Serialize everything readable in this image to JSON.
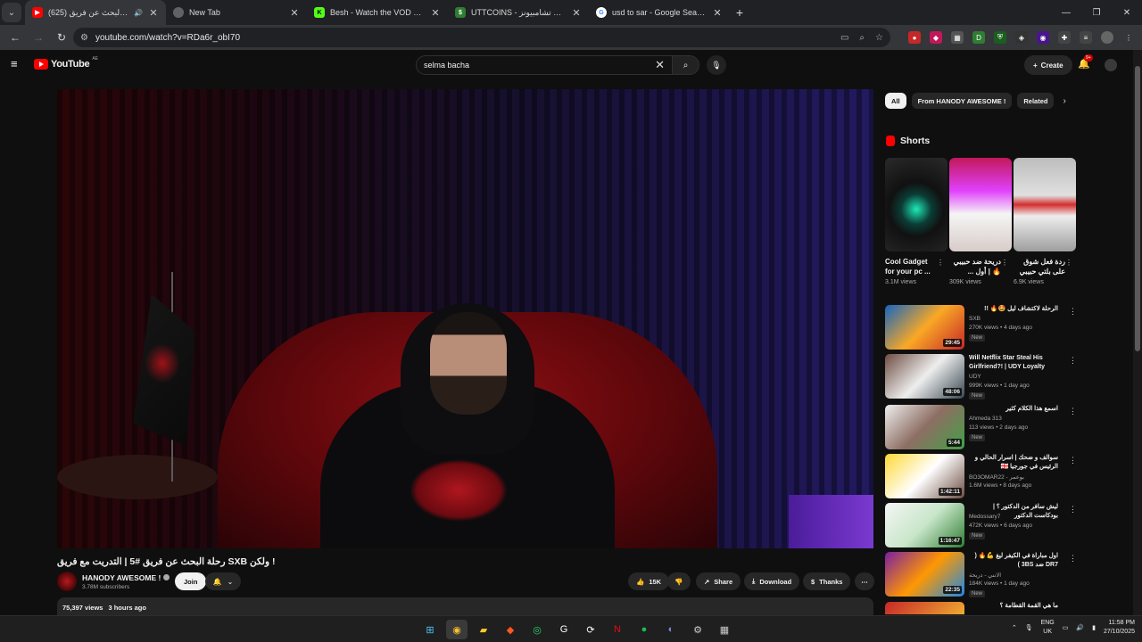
{
  "browser": {
    "tabs": [
      {
        "title": "رحلة البحث عن فريق (625) #",
        "fav_color": "#ff0000",
        "fav_icon": "youtube-icon"
      },
      {
        "title": "New Tab",
        "fav_color": "#5f6368",
        "fav_icon": "chrome-icon"
      },
      {
        "title": "Besh - Watch the VOD on Kick",
        "fav_color": "#53fc18",
        "fav_icon": "kick-icon"
      },
      {
        "title": "UTTCOINS - فوت تشامبيونز",
        "fav_color": "#2e7d32",
        "fav_icon": "uttcoins-icon"
      },
      {
        "title": "usd to sar - Google Search",
        "fav_color": "#ffffff",
        "fav_icon": "google-icon"
      }
    ],
    "url": "youtube.com/watch?v=RDa6r_obI70"
  },
  "youtube": {
    "logo_text": "YouTube",
    "region": "AE",
    "search_value": "selma bacha",
    "create_label": "Create",
    "notif_badge": "9+"
  },
  "video": {
    "title": "! ولكن SXB رحلة البحث عن فريق #5 | التدريت مع فريق",
    "channel": "HANODY AWESOME !",
    "subscribers": "3.78M subscribers",
    "join_label": "Join",
    "likes": "15K",
    "share_label": "Share",
    "download_label": "Download",
    "thanks_label": "Thanks",
    "views": "75,397 views",
    "posted": "3 hours ago"
  },
  "chips": [
    "All",
    "From HANODY AWESOME !",
    "Related"
  ],
  "shorts": {
    "heading": "Shorts",
    "items": [
      {
        "title": "Cool Gadget for your pc ...",
        "views": "3.1M views"
      },
      {
        "title": "دريحة ضد حبيبي 🔥 | أول ...",
        "views": "309K views"
      },
      {
        "title": "ردة فعل شوق على بلتي حبيبي ...",
        "views": "6.9K views"
      }
    ]
  },
  "recommended": [
    {
      "title": "الرحلة لاكتشاف ليل 🤩🔥 !!",
      "channel": "SXB",
      "meta": "270K views • 4 days ago",
      "badge": "New",
      "duration": "29:45"
    },
    {
      "title": "Will Netflix Star Steal His Girlfriend?! | UDY Loyalty Test",
      "channel": "UDY",
      "meta": "999K views • 1 day ago",
      "badge": "New",
      "duration": "48:06"
    },
    {
      "title": "اسمع هذا الكلام كثير",
      "channel": "Ahmeda 313",
      "meta": "113 views • 2 days ago",
      "badge": "New",
      "duration": "5:44"
    },
    {
      "title": "سوالف و ضحك | اسرار الحالي و الرئيس في جورجيا 🇬🇪",
      "channel": "BO3OMAR22 - بوعمر",
      "meta": "1.6M views • 8 days ago",
      "badge": "",
      "duration": "1:42:11"
    },
    {
      "title": "ليش سافر من الدكتور ؟ | بودكاست الدكتور",
      "channel": "Medossary7",
      "meta": "472K views • 6 days ago",
      "badge": "New",
      "duration": "1:16:47"
    },
    {
      "title": "اول مباراة في الكيفر ليغ 💪🔥 ( DR7 ضد 3BS )",
      "channel": "الانني - دريحة",
      "meta": "184K views • 1 day ago",
      "badge": "New",
      "duration": "22:35"
    },
    {
      "title": "ما هي القمة القطامة ؟",
      "channel": "",
      "meta": "",
      "badge": "",
      "duration": ""
    }
  ],
  "tray": {
    "lang_top": "ENG",
    "lang_bottom": "UK",
    "time": "11:58 PM",
    "date": "27/10/2025"
  }
}
